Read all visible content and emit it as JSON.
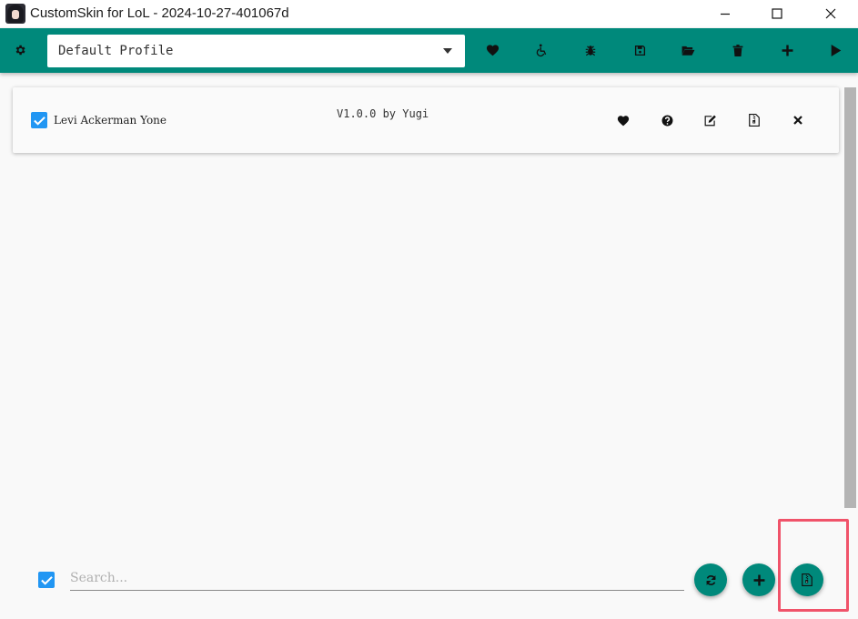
{
  "window": {
    "title": "CustomSkin for LoL - 2024-10-27-401067d",
    "controls": [
      "minimize",
      "maximize",
      "close"
    ]
  },
  "toolbar": {
    "profile_value": "Default Profile",
    "left_icon": "gear-icon",
    "right_icons": [
      "heart-icon",
      "accessibility-icon",
      "bug-icon",
      "save-icon",
      "folder-open-icon",
      "trash-icon",
      "plus-icon",
      "play-icon"
    ]
  },
  "mods": [
    {
      "checked": true,
      "name": "Levi Ackerman Yone",
      "version": "V1.0.0 by Yugi",
      "actions": [
        "heart-icon",
        "help-icon",
        "edit-icon",
        "file-zip-icon",
        "close-icon"
      ]
    }
  ],
  "bottom": {
    "select_all_checked": true,
    "search_placeholder": "Search...",
    "fab_icons": [
      "refresh-icon",
      "plus-icon",
      "file-zip-icon"
    ]
  },
  "colors": {
    "accent": "#00897b",
    "checkbox": "#2196f3",
    "highlight": "#f0536a"
  }
}
